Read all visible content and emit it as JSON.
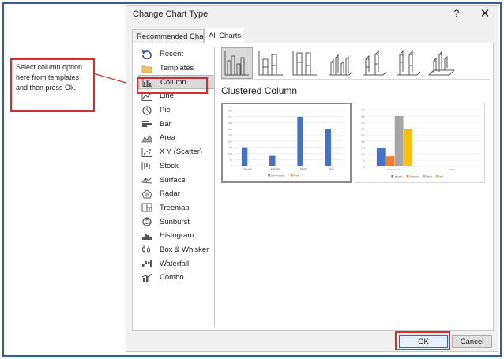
{
  "callout": {
    "text": "Select column oprion here from templates and then press Ok."
  },
  "dialog": {
    "title": "Change Chart Type",
    "help_label": "?",
    "close_label": "✕",
    "tabs": [
      {
        "label": "Recommended Charts",
        "active": false
      },
      {
        "label": "All Charts",
        "active": true
      }
    ],
    "sidebar": {
      "selected": "Column",
      "items": [
        {
          "label": "Recent",
          "icon": "recent-icon"
        },
        {
          "label": "Templates",
          "icon": "folder-icon"
        },
        {
          "label": "Column",
          "icon": "column-chart-icon"
        },
        {
          "label": "Line",
          "icon": "line-chart-icon"
        },
        {
          "label": "Pie",
          "icon": "pie-chart-icon"
        },
        {
          "label": "Bar",
          "icon": "bar-chart-icon"
        },
        {
          "label": "Area",
          "icon": "area-chart-icon"
        },
        {
          "label": "X Y (Scatter)",
          "icon": "scatter-chart-icon"
        },
        {
          "label": "Stock",
          "icon": "stock-chart-icon"
        },
        {
          "label": "Surface",
          "icon": "surface-chart-icon"
        },
        {
          "label": "Radar",
          "icon": "radar-chart-icon"
        },
        {
          "label": "Treemap",
          "icon": "treemap-icon"
        },
        {
          "label": "Sunburst",
          "icon": "sunburst-icon"
        },
        {
          "label": "Histogram",
          "icon": "histogram-icon"
        },
        {
          "label": "Box & Whisker",
          "icon": "box-whisker-icon"
        },
        {
          "label": "Waterfall",
          "icon": "waterfall-icon"
        },
        {
          "label": "Combo",
          "icon": "combo-chart-icon"
        }
      ]
    },
    "subtypes": [
      {
        "name": "clustered-column",
        "active": true
      },
      {
        "name": "stacked-column",
        "active": false
      },
      {
        "name": "100-stacked-column",
        "active": false
      },
      {
        "name": "3d-clustered-column",
        "active": false
      },
      {
        "name": "3d-stacked-column",
        "active": false
      },
      {
        "name": "3d-100-stacked-column",
        "active": false
      },
      {
        "name": "3d-column",
        "active": false
      }
    ],
    "subtype_title": "Clustered Column",
    "ok_label": "OK",
    "cancel_label": "Cancel"
  },
  "colors": {
    "accent_red": "#d32f2f",
    "series_blue": "#4472c4",
    "series_orange": "#ed7d31",
    "series_gray": "#a5a5a5",
    "series_yellow": "#ffc000"
  },
  "chart_data": [
    {
      "type": "bar",
      "categories": [
        "January",
        "February",
        "March",
        "April"
      ],
      "series": [
        {
          "name": "Sell Products",
          "values": [
            150,
            80,
            400,
            300
          ]
        },
        {
          "name": "Profit",
          "values": [
            0,
            0,
            0,
            0
          ]
        }
      ],
      "ylim": [
        0,
        450
      ],
      "yticks": [
        "0",
        "50",
        "100",
        "150",
        "200",
        "250",
        "300",
        "350",
        "400",
        "450"
      ],
      "legend": "bottom",
      "grid": true
    },
    {
      "type": "bar",
      "categories": [
        "Sell Products",
        "Profit"
      ],
      "series": [
        {
          "name": "January",
          "values": [
            150,
            0
          ]
        },
        {
          "name": "February",
          "values": [
            80,
            0
          ]
        },
        {
          "name": "March",
          "values": [
            400,
            0
          ]
        },
        {
          "name": "April",
          "values": [
            300,
            0
          ]
        }
      ],
      "ylim": [
        0,
        450
      ],
      "yticks": [
        "0",
        "50",
        "100",
        "150",
        "200",
        "250",
        "300",
        "350",
        "400",
        "450"
      ],
      "legend": "bottom",
      "grid": true
    }
  ]
}
